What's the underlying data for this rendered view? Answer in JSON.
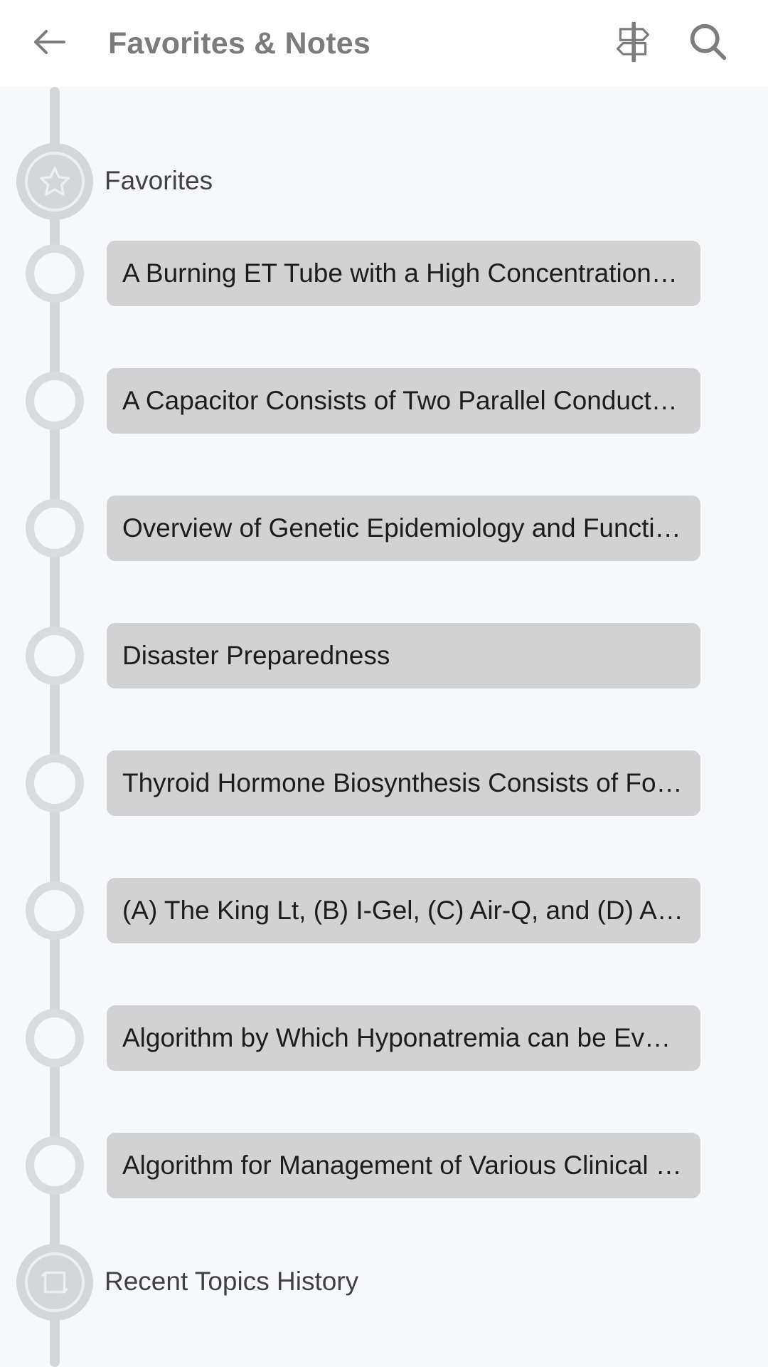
{
  "appbar": {
    "back_icon": "arrow-left-icon",
    "title": "Favorites & Notes",
    "actions": [
      {
        "icon": "signpost-icon",
        "name": "signpost-button"
      },
      {
        "icon": "search-icon",
        "name": "search-button"
      }
    ]
  },
  "colors": {
    "page_background": "#f6f8fb",
    "appbar_background": "#ffffff",
    "rail": "#d4d6d8",
    "node_ring": "#d9dbdd",
    "card_background": "#d2d2d2",
    "card_text": "#1d1d1d",
    "title_text": "#7b7b7b",
    "section_text": "#414141",
    "icon_stroke": "#7d7d7d"
  },
  "sections": [
    {
      "id": "favorites",
      "label": "Favorites",
      "icon": "star-icon",
      "items": [
        {
          "label": "A Burning ET Tube with a High Concentration o…"
        },
        {
          "label": "A Capacitor Consists of Two Parallel Conducto…"
        },
        {
          "label": "Overview of Genetic Epidemiology and Functio…"
        },
        {
          "label": "Disaster Preparedness"
        },
        {
          "label": "Thyroid Hormone Biosynthesis Consists of Fou…"
        },
        {
          "label": "(A) The King Lt, (B) I-Gel, (C) Air-Q, and (D) Aura-I"
        },
        {
          "label": "Algorithm by Which Hyponatremia can be Eval…"
        },
        {
          "label": "Algorithm for Management of Various Clinical …"
        }
      ]
    },
    {
      "id": "recent-topics-history",
      "label": "Recent Topics History",
      "icon": "history-refresh-icon",
      "items": []
    }
  ]
}
